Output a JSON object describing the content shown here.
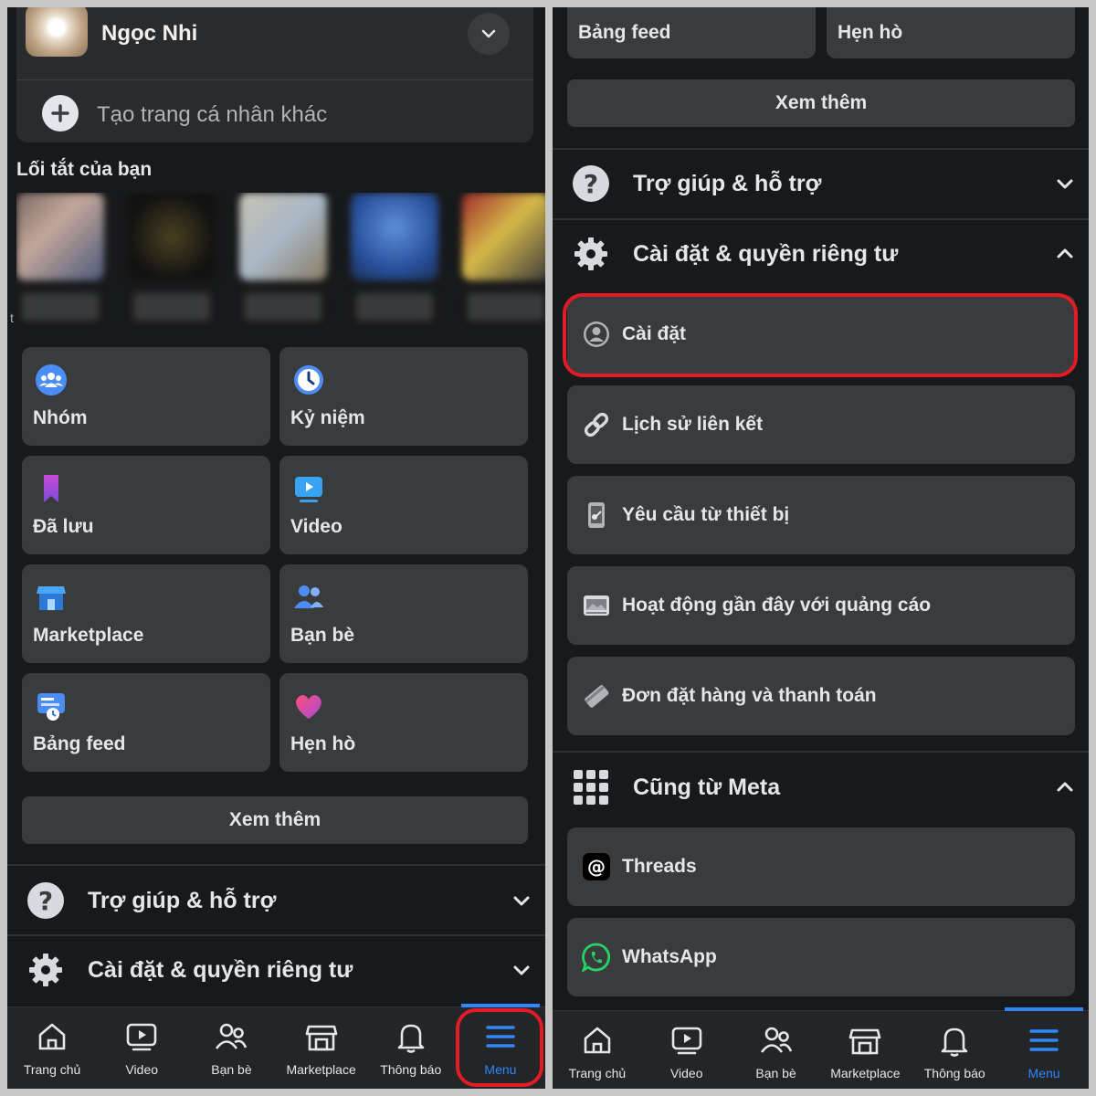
{
  "left": {
    "profile": {
      "name": "Ngọc Nhi",
      "create_label": "Tạo trang cá nhân khác"
    },
    "shortcuts_title": "Lối tắt của bạn",
    "shortcut_stray": "t",
    "tiles": [
      {
        "label": "Nhóm",
        "icon": "groups-icon"
      },
      {
        "label": "Kỷ niệm",
        "icon": "memories-clock-icon"
      },
      {
        "label": "Đã lưu",
        "icon": "saved-bookmark-icon"
      },
      {
        "label": "Video",
        "icon": "video-play-icon"
      },
      {
        "label": "Marketplace",
        "icon": "marketplace-store-icon"
      },
      {
        "label": "Bạn bè",
        "icon": "friends-icon"
      },
      {
        "label": "Bảng feed",
        "icon": "feeds-icon"
      },
      {
        "label": "Hẹn hò",
        "icon": "dating-heart-icon"
      }
    ],
    "see_more": "Xem thêm",
    "help": "Trợ giúp & hỗ trợ",
    "settings_privacy": "Cài đặt & quyền riêng tư"
  },
  "right": {
    "top_tiles": [
      "Bảng feed",
      "Hẹn hò"
    ],
    "see_more": "Xem thêm",
    "help": "Trợ giúp & hỗ trợ",
    "settings_privacy": "Cài đặt & quyền riêng tư",
    "settings_items": [
      {
        "label": "Cài đặt",
        "icon": "profile-settings-icon"
      },
      {
        "label": "Lịch sử liên kết",
        "icon": "link-icon"
      },
      {
        "label": "Yêu cầu từ thiết bị",
        "icon": "device-request-icon"
      },
      {
        "label": "Hoạt động gần đây với quảng cáo",
        "icon": "ad-activity-icon"
      },
      {
        "label": "Đơn đặt hàng và thanh toán",
        "icon": "payment-card-icon"
      }
    ],
    "meta_section": "Cũng từ Meta",
    "meta_items": [
      {
        "label": "Threads",
        "icon": "threads-icon"
      },
      {
        "label": "WhatsApp",
        "icon": "whatsapp-icon"
      }
    ]
  },
  "tabbar": {
    "tabs": [
      {
        "label": "Trang chủ",
        "icon": "home-icon"
      },
      {
        "label": "Video",
        "icon": "video-tab-icon"
      },
      {
        "label": "Bạn bè",
        "icon": "friends-tab-icon"
      },
      {
        "label": "Marketplace",
        "icon": "marketplace-tab-icon"
      },
      {
        "label": "Thông báo",
        "icon": "bell-icon"
      },
      {
        "label": "Menu",
        "icon": "menu-hamburger-icon"
      }
    ],
    "active_tab": "Menu"
  },
  "colors": {
    "accent": "#2d88ff",
    "highlight": "#e21b25",
    "background": "#18191a",
    "card": "#3a3b3c"
  }
}
